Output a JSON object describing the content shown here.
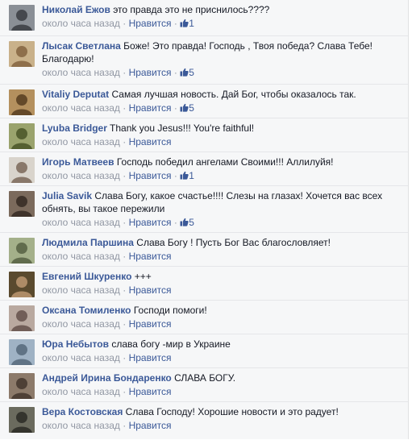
{
  "comments": [
    {
      "author": "Николай Ежов",
      "text": "это правда это не приснилось????",
      "time": "около часа назад",
      "like_label": "Нравится",
      "likes": "1",
      "avatar": {
        "bg": "#8a8f96",
        "fg": "#2d3036"
      }
    },
    {
      "author": "Лысак Светлана",
      "text": "Боже! Это правда! Господь , Твоя победа? Слава Тебе! Благодарю!",
      "time": "около часа назад",
      "like_label": "Нравится",
      "likes": "5",
      "avatar": {
        "bg": "#c9b18a",
        "fg": "#7a5a35"
      }
    },
    {
      "author": "Vitaliy Deputat",
      "text": "Самая лучшая новость. Дай Бог, чтобы оказалось так.",
      "time": "около часа назад",
      "like_label": "Нравится",
      "likes": "5",
      "avatar": {
        "bg": "#b4905e",
        "fg": "#4a3218"
      }
    },
    {
      "author": "Lyuba Bridger",
      "text": "Thank you Jesus!!! You're faithful!",
      "time": "около часа назад",
      "like_label": "Нравится",
      "likes": "",
      "avatar": {
        "bg": "#9aa36d",
        "fg": "#3e4a1e"
      }
    },
    {
      "author": "Игорь Матвеев",
      "text": "Господь победил ангелами Своими!!! Аллилуйя!",
      "time": "около часа назад",
      "like_label": "Нравится",
      "likes": "1",
      "avatar": {
        "bg": "#d9d4cc",
        "fg": "#6e5a4a"
      }
    },
    {
      "author": "Julia Savik",
      "text": "Слава Богу, какое счастье!!!! Слезы на глазах! Хочется вас всех обнять, вы такое пережили",
      "time": "около часа назад",
      "like_label": "Нравится",
      "likes": "5",
      "avatar": {
        "bg": "#7b6a5c",
        "fg": "#2b211b"
      }
    },
    {
      "author": "Людмила Паршина",
      "text": "Слава Богу ! Пусть Бог Вас благословляет!",
      "time": "около часа назад",
      "like_label": "Нравится",
      "likes": "",
      "avatar": {
        "bg": "#a4b08a",
        "fg": "#4b5538"
      }
    },
    {
      "author": "Евгений Шкуренко",
      "text": "+++",
      "time": "около часа назад",
      "like_label": "Нравится",
      "likes": "",
      "avatar": {
        "bg": "#5a4a2e",
        "fg": "#c9a27a"
      }
    },
    {
      "author": "Оксана Томиленко",
      "text": "Господи помоги!",
      "time": "около часа назад",
      "like_label": "Нравится",
      "likes": "",
      "avatar": {
        "bg": "#b9a9a0",
        "fg": "#5a4540"
      }
    },
    {
      "author": "Юра Небытов",
      "text": "слава богу -мир в Украине",
      "time": "около часа назад",
      "like_label": "Нравится",
      "likes": "",
      "avatar": {
        "bg": "#9fb2c4",
        "fg": "#4b5d70"
      }
    },
    {
      "author": "Андрей Ирина Бондаренко",
      "text": "СЛАВА БОГУ.",
      "time": "около часа назад",
      "like_label": "Нравится",
      "likes": "",
      "avatar": {
        "bg": "#8c7a6a",
        "fg": "#3a2e25"
      }
    },
    {
      "author": "Вера Костовская",
      "text": "Слава Господу! Хорошие новости и это радует!",
      "time": "около часа назад",
      "like_label": "Нравится",
      "likes": "",
      "avatar": {
        "bg": "#6b6b5e",
        "fg": "#22221d"
      }
    }
  ],
  "colors": {
    "link": "#3b5998",
    "meta": "#9197a3",
    "background": "#f6f7f8",
    "text": "#141823"
  },
  "icons": {
    "like": "thumbs-up-icon",
    "avatar": "user-avatar"
  }
}
